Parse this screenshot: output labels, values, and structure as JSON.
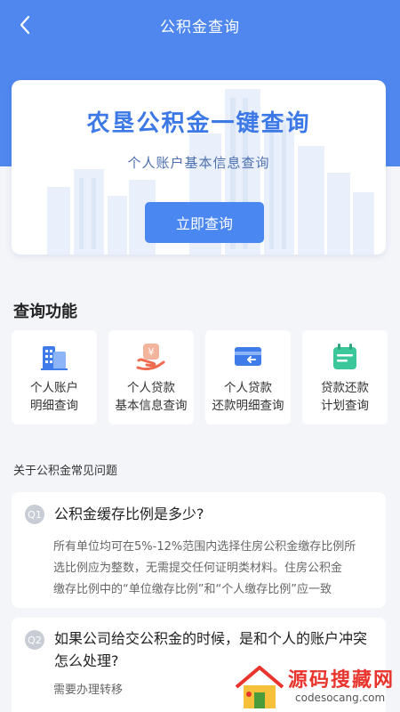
{
  "nav": {
    "title": "公积金查询"
  },
  "hero": {
    "title": "农垦公积金一键查询",
    "subtitle": "个人账户基本信息查询",
    "button": "立即查询"
  },
  "functions": {
    "title": "查询功能",
    "items": [
      {
        "line1": "个人账户",
        "line2": "明细查询",
        "icon": "building-icon"
      },
      {
        "line1": "个人贷款",
        "line2": "基本信息查询",
        "icon": "loan-yen-icon"
      },
      {
        "line1": "个人贷款",
        "line2": "还款明细查询",
        "icon": "card-refund-icon"
      },
      {
        "line1": "贷款还款",
        "line2": "计划查询",
        "icon": "calendar-icon"
      }
    ]
  },
  "faq": {
    "heading": "关于公积金常见问题",
    "items": [
      {
        "badge": "Q1",
        "question": "公积金缓存比例是多少?",
        "answer_lines": [
          "所有单位均可在5%-12%范围内选择住房公积金缴存比例所",
          "选比例应为整数，无需提交任何证明类材料。住房公积金",
          "缴存比例中的“单位缴存比例”和“个人缴存比例”应一致"
        ]
      },
      {
        "badge": "Q2",
        "question_lines": [
          "如果公司给交公积金的时候，是和个人的账户冲突",
          "怎么处理?"
        ],
        "answer": "需要办理转移"
      }
    ]
  },
  "watermark": {
    "text": "源码搜藏网",
    "sub": "codesocang.com"
  },
  "colors": {
    "primary": "#4f87ef",
    "hero_title": "#3d79e6",
    "background": "#f4f5f9"
  }
}
